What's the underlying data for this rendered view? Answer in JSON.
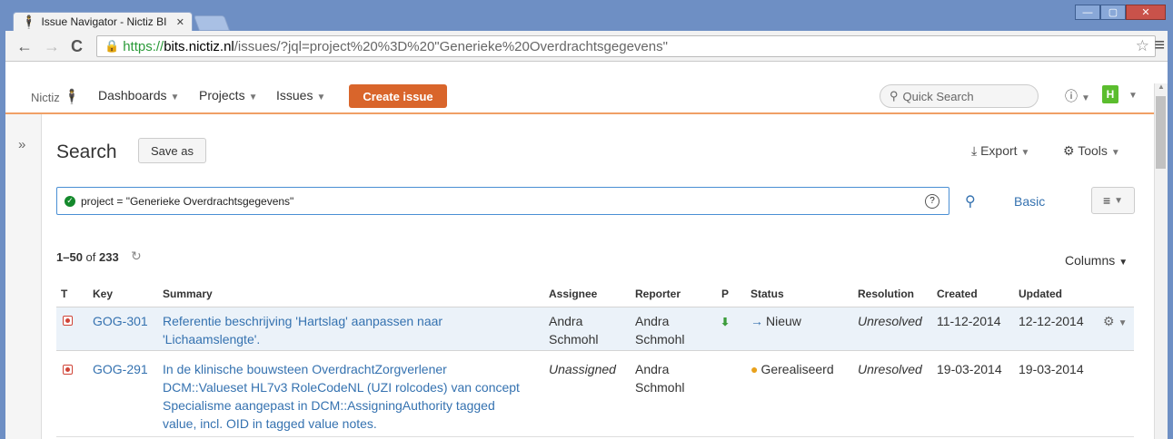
{
  "browser": {
    "tab_title": "Issue Navigator - Nictiz BI",
    "url_scheme": "https://",
    "url_host": "bits.nictiz.nl",
    "url_path": "/issues/?jql=project%20%3D%20\"Generieke%20Overdrachtsgegevens\""
  },
  "header": {
    "logo_text": "Nictiz",
    "nav": [
      "Dashboards",
      "Projects",
      "Issues"
    ],
    "create_label": "Create issue",
    "quick_search_placeholder": "Quick Search",
    "avatar_letter": "H"
  },
  "search": {
    "title": "Search",
    "save_as": "Save as",
    "export": "Export",
    "tools": "Tools",
    "jql": "project = \"Generieke Overdrachtsgegevens\"",
    "basic": "Basic",
    "range": "1–50",
    "of": "of",
    "total": "233",
    "columns": "Columns"
  },
  "table": {
    "headers": [
      "T",
      "Key",
      "Summary",
      "Assignee",
      "Reporter",
      "P",
      "Status",
      "Resolution",
      "Created",
      "Updated"
    ],
    "rows": [
      {
        "key": "GOG-301",
        "summary_lines": [
          "Referentie beschrijving 'Hartslag' aanpassen naar",
          "'Lichaamslengte'."
        ],
        "assignee_lines": [
          "Andra",
          "Schmohl"
        ],
        "reporter_lines": [
          "Andra",
          "Schmohl"
        ],
        "status": "Nieuw",
        "resolution": "Unresolved",
        "created": "11-12-2014",
        "updated": "12-12-2014"
      },
      {
        "key": "GOG-291",
        "summary_lines": [
          "In de klinische bouwsteen OverdrachtZorgverlener",
          "DCM::Valueset HL7v3 RoleCodeNL (UZI rolcodes) van concept",
          "Specialisme aangepast in DCM::AssigningAuthority tagged",
          "value, incl. OID in tagged value notes."
        ],
        "assignee": "Unassigned",
        "reporter_lines": [
          "Andra",
          "Schmohl"
        ],
        "status": "Gerealiseerd",
        "resolution": "Unresolved",
        "created": "19-03-2014",
        "updated": "19-03-2014"
      }
    ]
  }
}
